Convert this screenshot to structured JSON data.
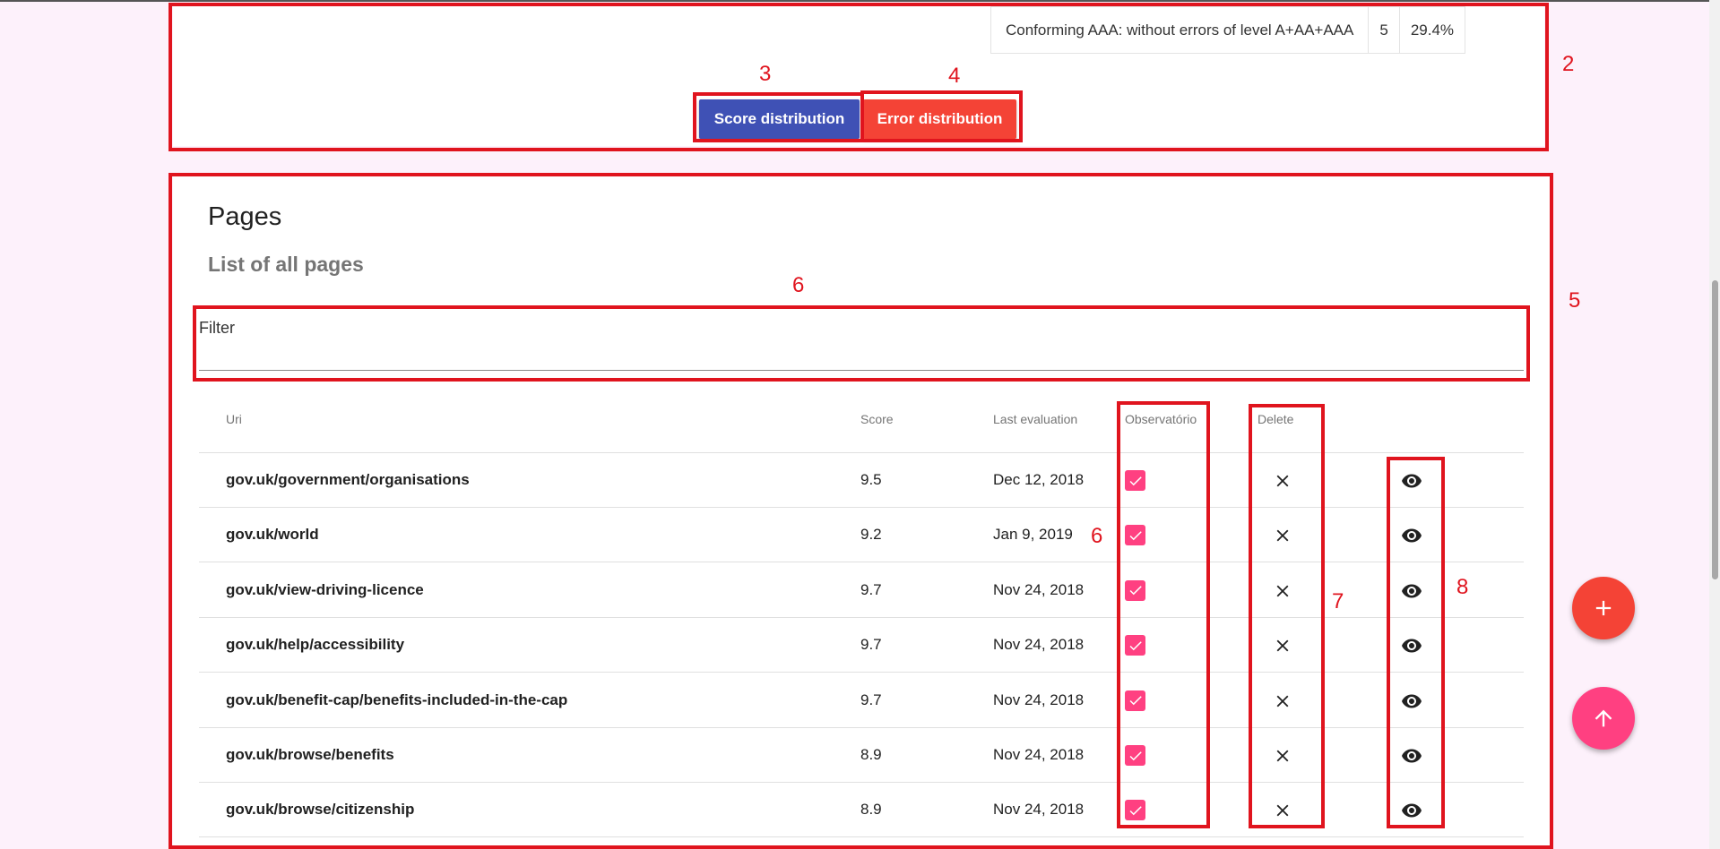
{
  "conformance": {
    "label": "Conforming AAA: without errors of level A+AA+AAA",
    "count": "5",
    "percent": "29.4%"
  },
  "buttons": {
    "score_distribution": "Score distribution",
    "error_distribution": "Error distribution"
  },
  "pages": {
    "title": "Pages",
    "subtitle": "List of all pages",
    "filter_label": "Filter",
    "filter_value": "",
    "columns": {
      "uri": "Uri",
      "score": "Score",
      "last_evaluation": "Last evaluation",
      "observatorio": "Observatório",
      "delete": "Delete"
    },
    "rows": [
      {
        "uri": "gov.uk/government/organisations",
        "score": "9.5",
        "date": "Dec 12, 2018",
        "observatorio": true
      },
      {
        "uri": "gov.uk/world",
        "score": "9.2",
        "date": "Jan 9, 2019",
        "observatorio": true
      },
      {
        "uri": "gov.uk/view-driving-licence",
        "score": "9.7",
        "date": "Nov 24, 2018",
        "observatorio": true
      },
      {
        "uri": "gov.uk/help/accessibility",
        "score": "9.7",
        "date": "Nov 24, 2018",
        "observatorio": true
      },
      {
        "uri": "gov.uk/benefit-cap/benefits-included-in-the-cap",
        "score": "9.7",
        "date": "Nov 24, 2018",
        "observatorio": true
      },
      {
        "uri": "gov.uk/browse/benefits",
        "score": "8.9",
        "date": "Nov 24, 2018",
        "observatorio": true
      },
      {
        "uri": "gov.uk/browse/citizenship",
        "score": "8.9",
        "date": "Nov 24, 2018",
        "observatorio": true
      }
    ]
  },
  "annotations": [
    "2",
    "3",
    "4",
    "5",
    "6",
    "6",
    "7",
    "8"
  ],
  "icons": {
    "checkbox": "checkbox-checked-icon",
    "delete": "close-icon",
    "view": "eye-icon",
    "fab_add": "plus-icon",
    "fab_up": "arrow-up-icon"
  },
  "colors": {
    "primary": "#3f51b5",
    "warn": "#f44336",
    "accent": "#ff4081",
    "annotation": "#e0141e",
    "background": "#fdf1fb"
  }
}
